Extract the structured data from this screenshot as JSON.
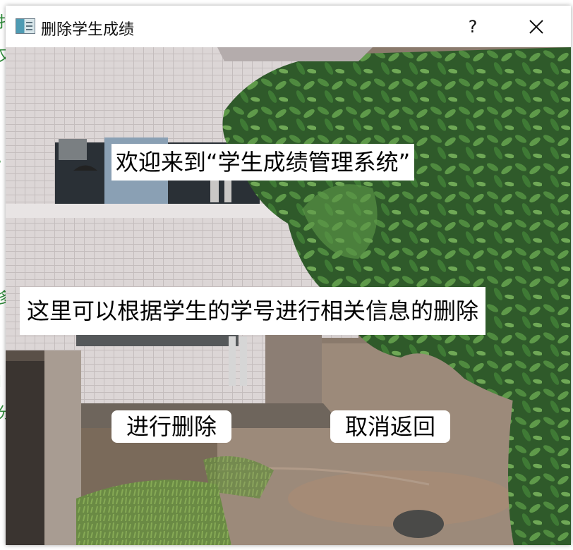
{
  "window": {
    "title": "删除学生成绩",
    "help_label": "?",
    "icons": {
      "app": "app-window-icon",
      "close": "close-icon"
    }
  },
  "content": {
    "welcome_text": "欢迎来到“学生成绩管理系统”",
    "info_text": "这里可以根据学生的学号进行相关信息的删除",
    "delete_button": "进行删除",
    "cancel_button": "取消返回"
  },
  "colors": {
    "label_bg": "#ffffff",
    "titlebar_bg": "#ffffff",
    "text": "#000000"
  }
}
